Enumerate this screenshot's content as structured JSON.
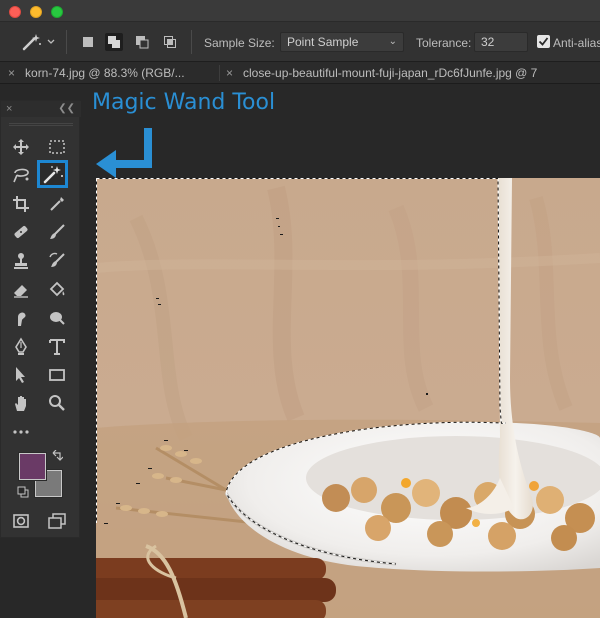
{
  "window": {
    "controls": [
      "close",
      "minimize",
      "maximize"
    ]
  },
  "options_bar": {
    "tool_icon": "magic-wand-icon",
    "selection_modes": [
      "new-selection-icon",
      "add-to-selection-icon",
      "subtract-from-selection-icon",
      "intersect-selection-icon"
    ],
    "active_selection_mode": "add-to-selection-icon",
    "sample_size_label": "Sample Size:",
    "sample_size_value": "Point Sample",
    "tolerance_label": "Tolerance:",
    "tolerance_value": "32",
    "anti_alias_label": "Anti-alias",
    "anti_alias_checked": true
  },
  "tabs": [
    {
      "label": "korn-74.jpg @ 88.3% (RGB/..."
    },
    {
      "label": "close-up-beautiful-mount-fuji-japan_rDc6fJunfe.jpg @ 7"
    }
  ],
  "toolbar": {
    "tools": [
      "move-icon",
      "rectangular-marquee-icon",
      "lasso-icon",
      "magic-wand-icon",
      "crop-icon",
      "eyedropper-icon",
      "healing-brush-icon",
      "brush-icon",
      "clone-stamp-icon",
      "history-brush-icon",
      "eraser-icon",
      "paint-bucket-icon",
      "smudge-icon",
      "dodge-icon",
      "pen-icon",
      "type-icon",
      "path-selection-icon",
      "rectangle-shape-icon",
      "hand-icon",
      "zoom-icon",
      "more-tools-icon"
    ],
    "active_tool": "magic-wand-icon",
    "foreground_color": "#6a3a66",
    "background_color": "#7a7a7a"
  },
  "annotation": {
    "text": "Magic Wand Tool",
    "color": "#2a8fd4"
  },
  "canvas": {
    "description_colors": {
      "backdrop": "#c9ab8f",
      "bowl": "#f2f0ee",
      "milk": "#f1ece4",
      "granola": "#c9965c",
      "cinnamon": "#7a3b1f"
    }
  }
}
